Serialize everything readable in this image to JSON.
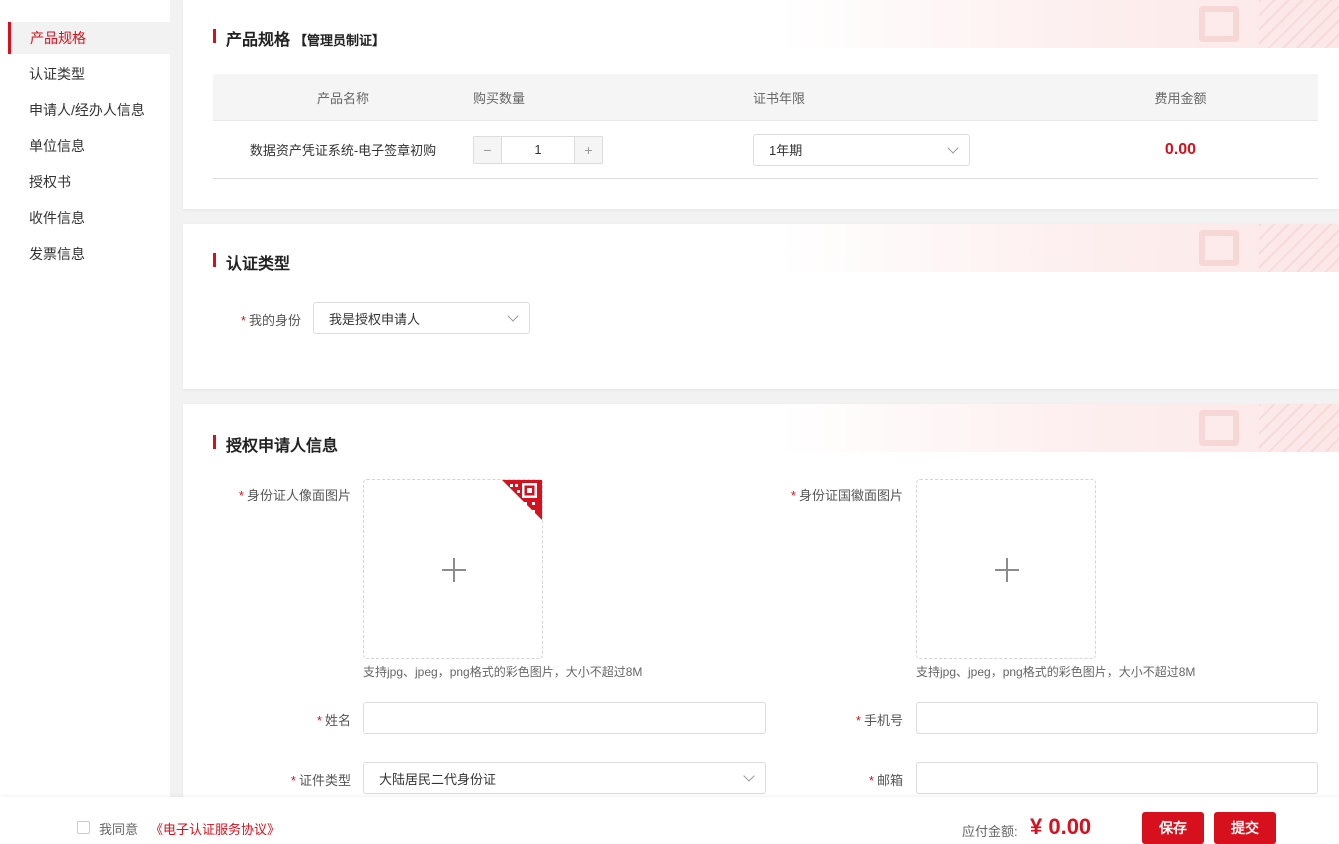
{
  "sidebar": {
    "items": [
      {
        "label": "产品规格"
      },
      {
        "label": "认证类型"
      },
      {
        "label": "申请人/经办人信息"
      },
      {
        "label": "单位信息"
      },
      {
        "label": "授权书"
      },
      {
        "label": "收件信息"
      },
      {
        "label": "发票信息"
      }
    ]
  },
  "product": {
    "title": "产品规格",
    "subtitle": "【管理员制证】",
    "headers": [
      "产品名称",
      "购买数量",
      "证书年限",
      "费用金额"
    ],
    "row": {
      "name": "数据资产凭证系统-电子签章初购",
      "minus": "−",
      "quantity": "1",
      "plus": "+",
      "period": "1年期",
      "fee": "0.00"
    }
  },
  "auth": {
    "title": "认证类型",
    "required_mark": "*",
    "identity_label": "我的身份",
    "identity_value": "我是授权申请人"
  },
  "applicant": {
    "title": "授权申请人信息",
    "required_mark": "*",
    "id_front_label": "身份证人像面图片",
    "id_back_label": "身份证国徽面图片",
    "upload_hint": "支持jpg、jpeg，png格式的彩色图片，大小不超过8M",
    "name_label": "姓名",
    "phone_label": "手机号",
    "id_type_label": "证件类型",
    "id_type_value": "大陆居民二代身份证",
    "email_label": "邮箱"
  },
  "footer": {
    "agree_text": "我同意",
    "agreement_link": "《电子认证服务协议》",
    "amount_label": "应付金额:",
    "amount": "¥ 0.00",
    "save_label": "保存",
    "submit_label": "提交"
  },
  "colors": {
    "accent": "#d7101d",
    "background": "#f2f2f2"
  }
}
